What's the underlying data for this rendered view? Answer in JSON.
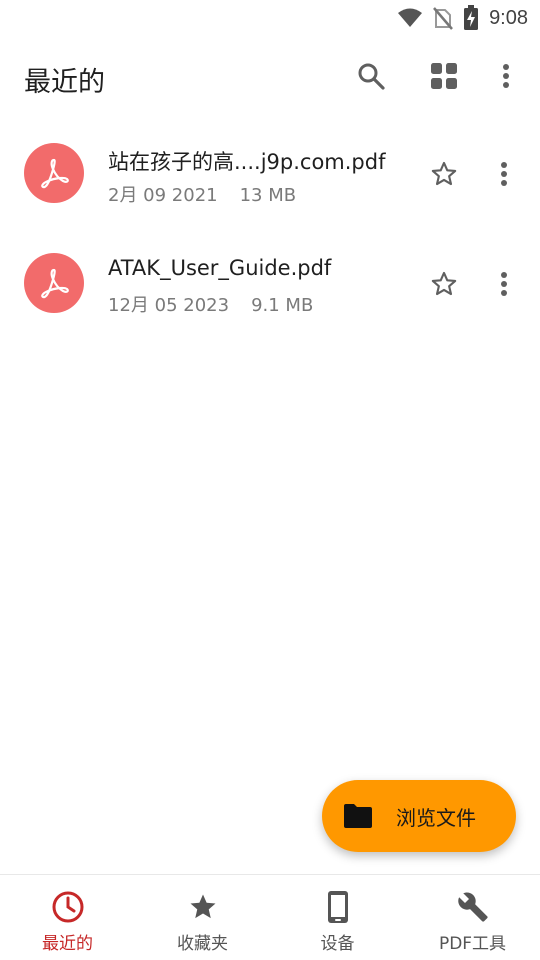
{
  "status_bar": {
    "time": "9:08"
  },
  "header": {
    "title": "最近的"
  },
  "files": [
    {
      "name": "站在孩子的高....j9p.com.pdf",
      "date": "2月 09 2021",
      "size": "13 MB"
    },
    {
      "name": "ATAK_User_Guide.pdf",
      "date": "12月 05 2023",
      "size": "9.1 MB"
    }
  ],
  "fab": {
    "label": "浏览文件"
  },
  "bottom_nav": {
    "recent": "最近的",
    "favorites": "收藏夹",
    "devices": "设备",
    "tools": "PDF工具"
  },
  "colors": {
    "accent": "#ff9800",
    "pdf_icon": "#f26b6b",
    "active_nav": "#c62828"
  }
}
